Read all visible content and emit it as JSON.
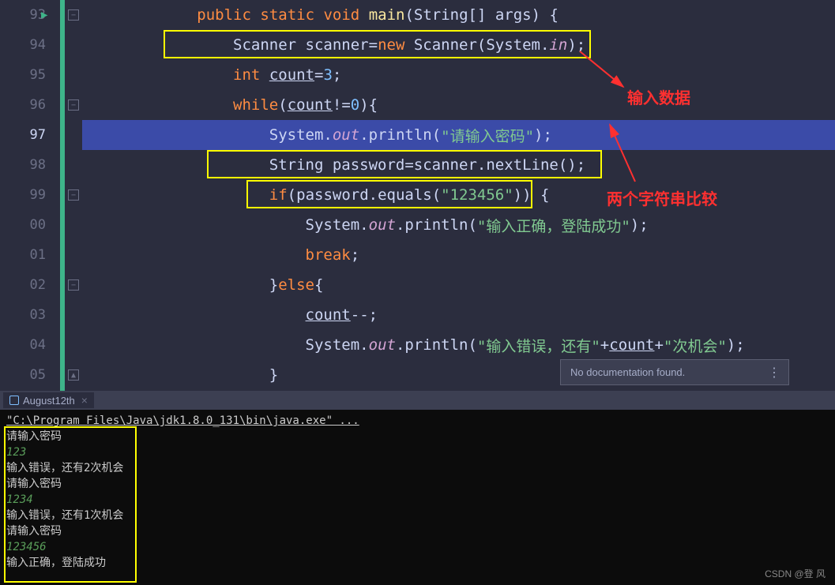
{
  "lineNumbers": [
    "93",
    "94",
    "95",
    "96",
    "97",
    "98",
    "99",
    "00",
    "01",
    "02",
    "03",
    "04",
    "05"
  ],
  "currentLine": 97,
  "code": {
    "l93": {
      "indent": "            ",
      "tokens": [
        {
          "t": "public",
          "c": "kw"
        },
        {
          "t": " ",
          "c": "ident"
        },
        {
          "t": "static",
          "c": "kw"
        },
        {
          "t": " ",
          "c": "ident"
        },
        {
          "t": "void",
          "c": "kw"
        },
        {
          "t": " ",
          "c": "ident"
        },
        {
          "t": "main",
          "c": "method"
        },
        {
          "t": "(String[] args) {",
          "c": "ident"
        }
      ]
    },
    "l94": {
      "indent": "                ",
      "tokens": [
        {
          "t": "Scanner scanner=",
          "c": "ident"
        },
        {
          "t": "new",
          "c": "kw"
        },
        {
          "t": " Scanner(System.",
          "c": "ident"
        },
        {
          "t": "in",
          "c": "field"
        },
        {
          "t": ");",
          "c": "ident"
        }
      ]
    },
    "l95": {
      "indent": "                ",
      "tokens": [
        {
          "t": "int",
          "c": "kw"
        },
        {
          "t": " ",
          "c": "ident"
        },
        {
          "t": "count",
          "c": "ident underline"
        },
        {
          "t": "=",
          "c": "ident"
        },
        {
          "t": "3",
          "c": "num"
        },
        {
          "t": ";",
          "c": "ident"
        }
      ]
    },
    "l96": {
      "indent": "                ",
      "tokens": [
        {
          "t": "while",
          "c": "kw"
        },
        {
          "t": "(",
          "c": "ident"
        },
        {
          "t": "count",
          "c": "ident underline"
        },
        {
          "t": "!=",
          "c": "ident"
        },
        {
          "t": "0",
          "c": "num"
        },
        {
          "t": "){",
          "c": "ident"
        }
      ]
    },
    "l97": {
      "indent": "                    ",
      "tokens": [
        {
          "t": "System.",
          "c": "ident"
        },
        {
          "t": "out",
          "c": "field"
        },
        {
          "t": ".println(",
          "c": "ident"
        },
        {
          "t": "\"请输入密码\"",
          "c": "str"
        },
        {
          "t": ");",
          "c": "ident"
        }
      ]
    },
    "l98": {
      "indent": "                    ",
      "tokens": [
        {
          "t": "String password=scanner.nextLine();",
          "c": "ident"
        }
      ]
    },
    "l99": {
      "indent": "                    ",
      "tokens": [
        {
          "t": "if",
          "c": "kw"
        },
        {
          "t": "(",
          "c": "ident"
        },
        {
          "t": "password.equals(",
          "c": "ident"
        },
        {
          "t": "\"123456\"",
          "c": "str"
        },
        {
          "t": ")) {",
          "c": "ident"
        }
      ]
    },
    "l00": {
      "indent": "                        ",
      "tokens": [
        {
          "t": "System.",
          "c": "ident"
        },
        {
          "t": "out",
          "c": "field"
        },
        {
          "t": ".println(",
          "c": "ident"
        },
        {
          "t": "\"输入正确，登陆成功\"",
          "c": "str"
        },
        {
          "t": ");",
          "c": "ident"
        }
      ]
    },
    "l01": {
      "indent": "                        ",
      "tokens": [
        {
          "t": "break",
          "c": "kw"
        },
        {
          "t": ";",
          "c": "ident"
        }
      ]
    },
    "l02": {
      "indent": "                    ",
      "tokens": [
        {
          "t": "}",
          "c": "ident"
        },
        {
          "t": "else",
          "c": "kw"
        },
        {
          "t": "{",
          "c": "ident"
        }
      ]
    },
    "l03": {
      "indent": "                        ",
      "tokens": [
        {
          "t": "count",
          "c": "ident underline"
        },
        {
          "t": "--;",
          "c": "ident"
        }
      ]
    },
    "l04": {
      "indent": "                        ",
      "tokens": [
        {
          "t": "System.",
          "c": "ident"
        },
        {
          "t": "out",
          "c": "field"
        },
        {
          "t": ".println(",
          "c": "ident"
        },
        {
          "t": "\"输入错误，还有\"",
          "c": "str"
        },
        {
          "t": "+",
          "c": "ident"
        },
        {
          "t": "count",
          "c": "ident underline"
        },
        {
          "t": "+",
          "c": "ident"
        },
        {
          "t": "\"次机会\"",
          "c": "str"
        },
        {
          "t": ");",
          "c": "ident"
        }
      ]
    },
    "l05": {
      "indent": "                    ",
      "tokens": [
        {
          "t": "}",
          "c": "ident"
        }
      ]
    }
  },
  "annotations": {
    "input_data": "输入数据",
    "string_compare": "两个字符串比较"
  },
  "tooltip": {
    "text": "No documentation found.",
    "dots": "⋮"
  },
  "tab": {
    "name": "August12th",
    "close": "×"
  },
  "terminal": {
    "cmd": "\"C:\\Program Files\\Java\\jdk1.8.0_131\\bin\\java.exe\" ...",
    "lines": [
      {
        "text": "请输入密码",
        "cls": ""
      },
      {
        "text": "123",
        "cls": "input"
      },
      {
        "text": "输入错误，还有2次机会",
        "cls": ""
      },
      {
        "text": "请输入密码",
        "cls": ""
      },
      {
        "text": "1234",
        "cls": "input"
      },
      {
        "text": "输入错误，还有1次机会",
        "cls": ""
      },
      {
        "text": "请输入密码",
        "cls": ""
      },
      {
        "text": "123456",
        "cls": "input"
      },
      {
        "text": "输入正确，登陆成功",
        "cls": ""
      }
    ]
  },
  "watermark": "CSDN @登 风"
}
